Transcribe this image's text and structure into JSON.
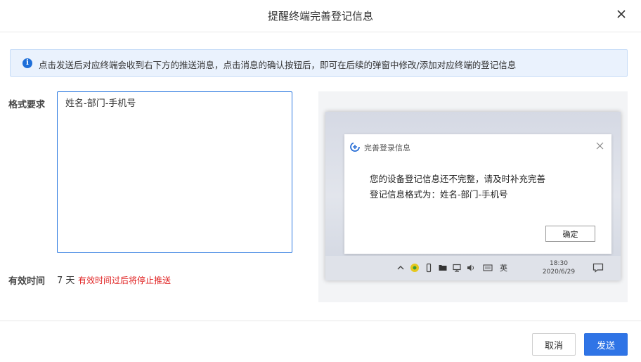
{
  "dialog": {
    "title": "提醒终端完善登记信息",
    "close_icon": "close-icon"
  },
  "info": {
    "icon": "info-icon",
    "icon_glyph": "i",
    "text": "点击发送后对应终端会收到右下方的推送消息，点击消息的确认按钮后，即可在后续的弹窗中修改/添加对应终端的登记信息"
  },
  "form": {
    "format_label": "格式要求",
    "format_value": "姓名-部门-手机号",
    "valid_label": "有效时间",
    "valid_value": "7 天",
    "valid_note": "有效时间过后将停止推送"
  },
  "preview": {
    "popup_title": "完善登录信息",
    "message_line1": "您的设备登记信息还不完整，请及时补充完善",
    "message_line2": "登记信息格式为：姓名-部门-手机号",
    "ok_label": "确定",
    "clock_time": "18:30",
    "clock_date": "2020/6/29",
    "tray_ime": "英"
  },
  "footer": {
    "cancel_label": "取消",
    "send_label": "发送"
  },
  "colors": {
    "primary": "#2f74e6",
    "info_bg": "#eaf2fd",
    "warning_text": "#e02020"
  }
}
